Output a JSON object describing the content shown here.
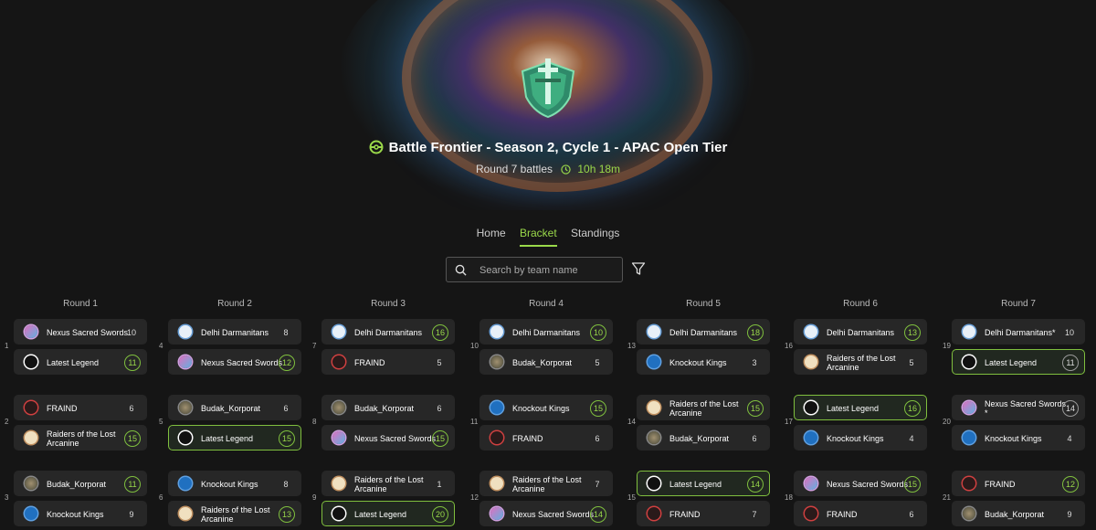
{
  "header": {
    "title": "Battle Frontier - Season 2, Cycle 1 - APAC Open Tier",
    "round_status": "Round 7 battles",
    "timer": "10h 18m"
  },
  "nav": {
    "tabs": [
      "Home",
      "Bracket",
      "Standings"
    ],
    "active": "Bracket"
  },
  "search": {
    "placeholder": "Search by team name",
    "value": ""
  },
  "colors": {
    "accent": "#9ad94a",
    "win_border": "#7fbf3e",
    "background": "#151515",
    "card": "#272727"
  },
  "rounds": [
    {
      "label": "Round 1",
      "matches": [
        {
          "num": "1",
          "teams": [
            {
              "name": "Nexus Sacred Swords",
              "score": "10",
              "win": false,
              "avatar": "nexus"
            },
            {
              "name": "Latest Legend",
              "score": "11",
              "win": true,
              "avatar": "legend"
            }
          ]
        },
        {
          "num": "2",
          "teams": [
            {
              "name": "FRAIND",
              "score": "6",
              "win": false,
              "avatar": "fraind"
            },
            {
              "name": "Raiders of the Lost Arcanine",
              "score": "15",
              "win": true,
              "avatar": "raiders"
            }
          ]
        },
        {
          "num": "3",
          "teams": [
            {
              "name": "Budak_Korporat",
              "score": "11",
              "win": true,
              "avatar": "budak"
            },
            {
              "name": "Knockout Kings",
              "score": "9",
              "win": false,
              "avatar": "knockout"
            }
          ]
        }
      ]
    },
    {
      "label": "Round 2",
      "matches": [
        {
          "num": "4",
          "teams": [
            {
              "name": "Delhi Darmanitans",
              "score": "8",
              "win": false,
              "avatar": "delhi"
            },
            {
              "name": "Nexus Sacred Swords",
              "score": "12",
              "win": true,
              "avatar": "nexus"
            }
          ]
        },
        {
          "num": "5",
          "teams": [
            {
              "name": "Budak_Korporat",
              "score": "6",
              "win": false,
              "avatar": "budak"
            },
            {
              "name": "Latest Legend",
              "score": "15",
              "win": true,
              "avatar": "legend",
              "highlight": true
            }
          ]
        },
        {
          "num": "6",
          "teams": [
            {
              "name": "Knockout Kings",
              "score": "8",
              "win": false,
              "avatar": "knockout"
            },
            {
              "name": "Raiders of the Lost Arcanine",
              "score": "13",
              "win": true,
              "avatar": "raiders"
            }
          ]
        }
      ]
    },
    {
      "label": "Round 3",
      "matches": [
        {
          "num": "7",
          "teams": [
            {
              "name": "Delhi Darmanitans",
              "score": "16",
              "win": true,
              "avatar": "delhi"
            },
            {
              "name": "FRAIND",
              "score": "5",
              "win": false,
              "avatar": "fraind"
            }
          ]
        },
        {
          "num": "8",
          "teams": [
            {
              "name": "Budak_Korporat",
              "score": "6",
              "win": false,
              "avatar": "budak"
            },
            {
              "name": "Nexus Sacred Swords",
              "score": "15",
              "win": true,
              "avatar": "nexus"
            }
          ]
        },
        {
          "num": "9",
          "teams": [
            {
              "name": "Raiders of the Lost Arcanine",
              "score": "1",
              "win": false,
              "avatar": "raiders"
            },
            {
              "name": "Latest Legend",
              "score": "20",
              "win": true,
              "avatar": "legend",
              "highlight": true
            }
          ]
        }
      ]
    },
    {
      "label": "Round 4",
      "matches": [
        {
          "num": "10",
          "teams": [
            {
              "name": "Delhi Darmanitans",
              "score": "10",
              "win": true,
              "avatar": "delhi"
            },
            {
              "name": "Budak_Korporat",
              "score": "5",
              "win": false,
              "avatar": "budak"
            }
          ]
        },
        {
          "num": "11",
          "teams": [
            {
              "name": "Knockout Kings",
              "score": "15",
              "win": true,
              "avatar": "knockout"
            },
            {
              "name": "FRAIND",
              "score": "6",
              "win": false,
              "avatar": "fraind"
            }
          ]
        },
        {
          "num": "12",
          "teams": [
            {
              "name": "Raiders of the Lost Arcanine",
              "score": "7",
              "win": false,
              "avatar": "raiders"
            },
            {
              "name": "Nexus Sacred Swords",
              "score": "14",
              "win": true,
              "avatar": "nexus"
            }
          ]
        }
      ]
    },
    {
      "label": "Round 5",
      "matches": [
        {
          "num": "13",
          "teams": [
            {
              "name": "Delhi Darmanitans",
              "score": "18",
              "win": true,
              "avatar": "delhi"
            },
            {
              "name": "Knockout Kings",
              "score": "3",
              "win": false,
              "avatar": "knockout"
            }
          ]
        },
        {
          "num": "14",
          "teams": [
            {
              "name": "Raiders of the Lost Arcanine",
              "score": "15",
              "win": true,
              "avatar": "raiders"
            },
            {
              "name": "Budak_Korporat",
              "score": "6",
              "win": false,
              "avatar": "budak"
            }
          ]
        },
        {
          "num": "15",
          "teams": [
            {
              "name": "Latest Legend",
              "score": "14",
              "win": true,
              "avatar": "legend",
              "highlight": true
            },
            {
              "name": "FRAIND",
              "score": "7",
              "win": false,
              "avatar": "fraind"
            }
          ]
        }
      ]
    },
    {
      "label": "Round 6",
      "matches": [
        {
          "num": "16",
          "teams": [
            {
              "name": "Delhi Darmanitans",
              "score": "13",
              "win": true,
              "avatar": "delhi"
            },
            {
              "name": "Raiders of the Lost Arcanine",
              "score": "5",
              "win": false,
              "avatar": "raiders"
            }
          ]
        },
        {
          "num": "17",
          "teams": [
            {
              "name": "Latest Legend",
              "score": "16",
              "win": true,
              "avatar": "legend",
              "highlight": true
            },
            {
              "name": "Knockout Kings",
              "score": "4",
              "win": false,
              "avatar": "knockout"
            }
          ]
        },
        {
          "num": "18",
          "teams": [
            {
              "name": "Nexus Sacred Swords",
              "score": "15",
              "win": true,
              "avatar": "nexus"
            },
            {
              "name": "FRAIND",
              "score": "6",
              "win": false,
              "avatar": "fraind"
            }
          ]
        }
      ]
    },
    {
      "label": "Round 7",
      "matches": [
        {
          "num": "19",
          "teams": [
            {
              "name": "Delhi Darmanitans*",
              "score": "10",
              "win": false,
              "avatar": "delhi"
            },
            {
              "name": "Latest Legend",
              "score": "11",
              "win": false,
              "circle": true,
              "avatar": "legend",
              "highlight": true
            }
          ]
        },
        {
          "num": "20",
          "teams": [
            {
              "name": "Nexus Sacred Swords *",
              "score": "14",
              "win": false,
              "circle": true,
              "avatar": "nexus"
            },
            {
              "name": "Knockout Kings",
              "score": "4",
              "win": false,
              "avatar": "knockout"
            }
          ]
        },
        {
          "num": "21",
          "teams": [
            {
              "name": "FRAIND",
              "score": "12",
              "win": true,
              "avatar": "fraind"
            },
            {
              "name": "Budak_Korporat",
              "score": "9",
              "win": false,
              "avatar": "budak"
            }
          ]
        }
      ]
    }
  ]
}
